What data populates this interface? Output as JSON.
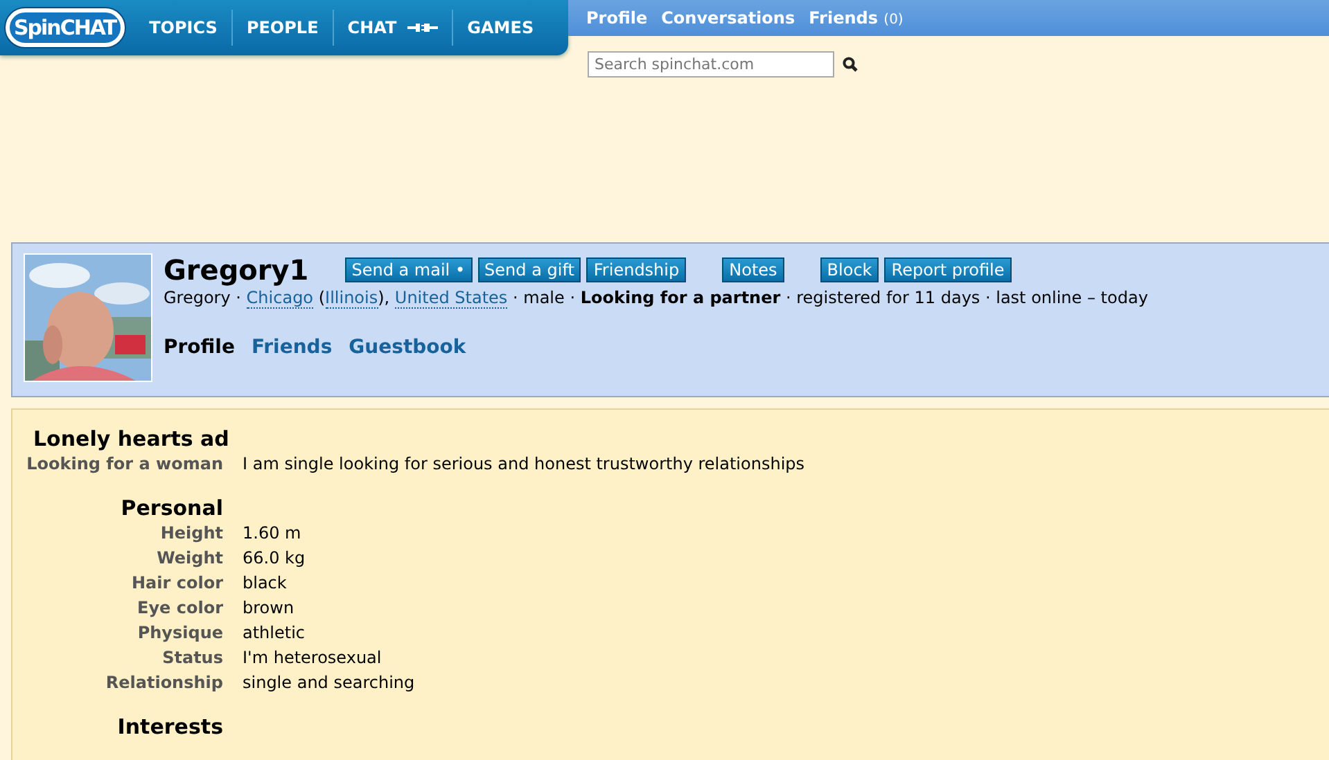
{
  "logo": {
    "text": "SpinCHAT"
  },
  "nav": [
    {
      "label": "TOPICS",
      "kind": "text"
    },
    {
      "label": "PEOPLE",
      "kind": "text"
    },
    {
      "label": "CHAT",
      "kind": "plug"
    },
    {
      "label": "GAMES",
      "kind": "text"
    }
  ],
  "user_menu": [
    {
      "label": "Profile"
    },
    {
      "label": "Conversations"
    },
    {
      "label": "Friends",
      "count": "(0)"
    }
  ],
  "search": {
    "placeholder": "Search spinchat.com"
  },
  "profile": {
    "username": "Gregory1",
    "action_groups": [
      [
        "Send a mail •",
        "Send a gift",
        "Friendship"
      ],
      [
        "Notes"
      ],
      [
        "Block",
        "Report profile"
      ]
    ],
    "meta": [
      {
        "kind": "text",
        "text": "Gregory · "
      },
      {
        "kind": "link",
        "text": "Chicago"
      },
      {
        "kind": "text",
        "text": " ("
      },
      {
        "kind": "link",
        "text": "Illinois"
      },
      {
        "kind": "text",
        "text": "), "
      },
      {
        "kind": "link",
        "text": "United States"
      },
      {
        "kind": "text",
        "text": " · male · "
      },
      {
        "kind": "bold",
        "text": "Looking for a partner"
      },
      {
        "kind": "text",
        "text": " · registered for 11 days · last online – today"
      }
    ],
    "tabs": [
      {
        "label": "Profile",
        "selected": true
      },
      {
        "label": "Friends",
        "selected": false
      },
      {
        "label": "Guestbook",
        "selected": false
      }
    ]
  },
  "sections": [
    {
      "title": "Lonely hearts ad",
      "rows": [
        {
          "label": "Looking for a woman",
          "value": "I am single looking for serious and honest trustworthy relationships"
        }
      ]
    },
    {
      "title": "Personal",
      "rows": [
        {
          "label": "Height",
          "value": "1.60 m"
        },
        {
          "label": "Weight",
          "value": "66.0 kg"
        },
        {
          "label": "Hair color",
          "value": "black"
        },
        {
          "label": "Eye color",
          "value": "brown"
        },
        {
          "label": "Physique",
          "value": "athletic"
        },
        {
          "label": "Status",
          "value": "I'm heterosexual"
        },
        {
          "label": "Relationship",
          "value": "single and searching"
        }
      ]
    },
    {
      "title": "Interests"
    }
  ]
}
